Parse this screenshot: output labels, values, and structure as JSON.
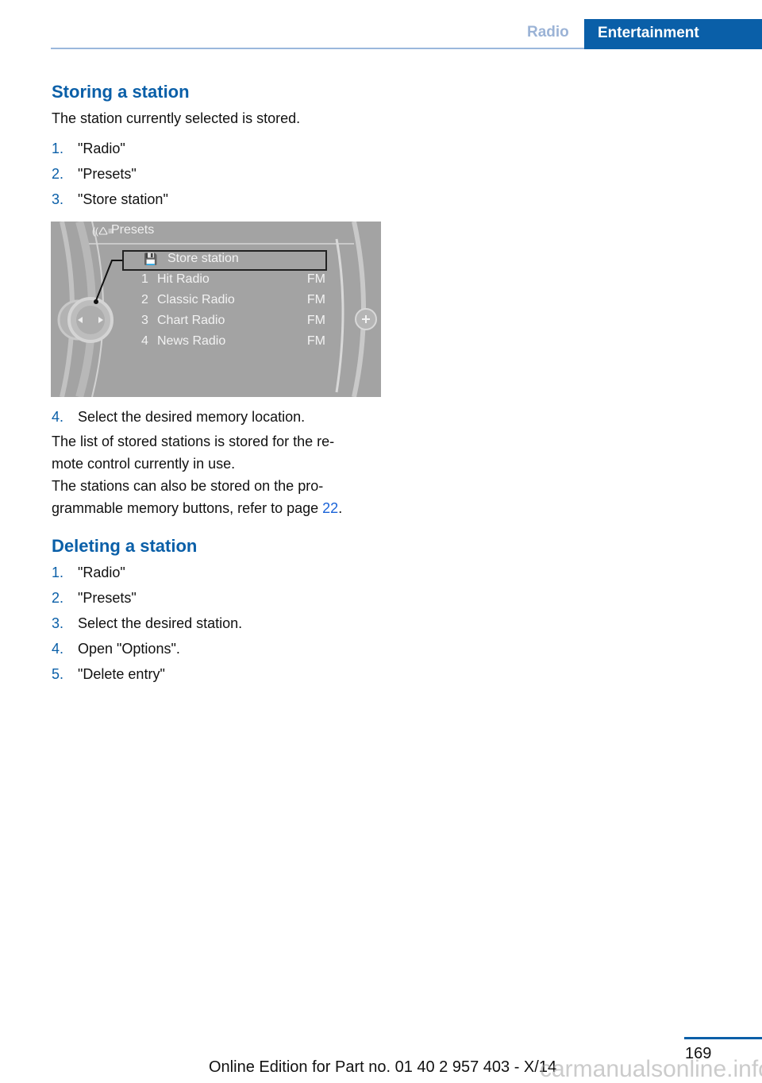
{
  "header": {
    "section_tab": "Radio",
    "chapter_tab": "Entertainment"
  },
  "storing": {
    "heading": "Storing a station",
    "intro": "The station currently selected is stored.",
    "steps": [
      {
        "num": "1.",
        "text": "\"Radio\""
      },
      {
        "num": "2.",
        "text": "\"Presets\""
      },
      {
        "num": "3.",
        "text": "\"Store station\""
      },
      {
        "num": "4.",
        "text": "Select the desired memory location."
      }
    ],
    "note1": "The list of stored stations is stored for the re-mote control currently in use.",
    "note1_line1": "The list of stored stations is stored for the re-",
    "note1_line2": "mote control currently in use.",
    "note2_line1": "The stations can also be stored on the pro-",
    "note2_line2": "grammable memory buttons, refer to page ",
    "note2_link": "22",
    "note2_end": "."
  },
  "screen": {
    "title": "Presets",
    "store_label": "Store station",
    "presets": [
      {
        "num": "1",
        "name": "Hit Radio",
        "band": "FM"
      },
      {
        "num": "2",
        "name": "Classic Radio",
        "band": "FM"
      },
      {
        "num": "3",
        "name": "Chart Radio",
        "band": "FM"
      },
      {
        "num": "4",
        "name": "News Radio",
        "band": "FM"
      }
    ]
  },
  "deleting": {
    "heading": "Deleting a station",
    "steps": [
      {
        "num": "1.",
        "text": "\"Radio\""
      },
      {
        "num": "2.",
        "text": "\"Presets\""
      },
      {
        "num": "3.",
        "text": "Select the desired station."
      },
      {
        "num": "4.",
        "text": "Open \"Options\"."
      },
      {
        "num": "5.",
        "text": "\"Delete entry\""
      }
    ]
  },
  "footer": {
    "page_number": "169",
    "edition": "Online Edition for Part no. 01 40 2 957 403 - X/14",
    "watermark": "carmanualsonline.info"
  }
}
